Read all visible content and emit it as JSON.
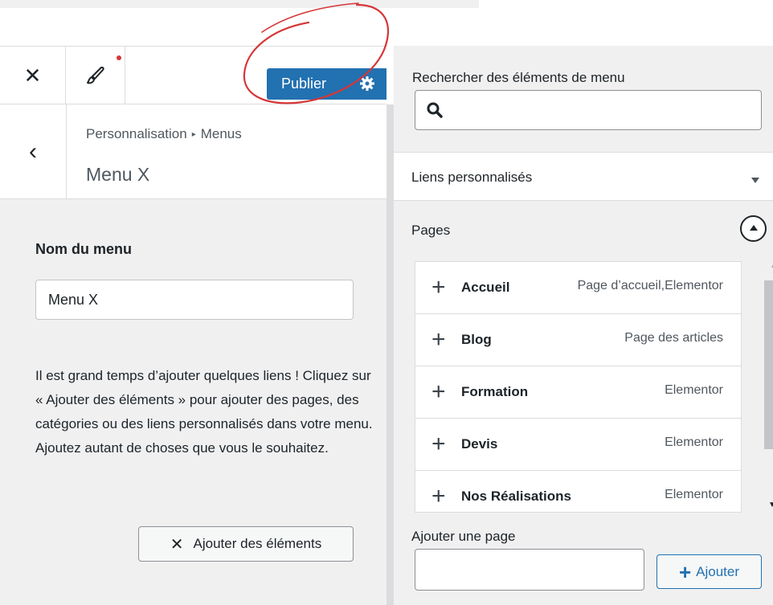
{
  "header": {
    "close_icon": "close-icon",
    "brush_icon": "paintbrush-icon",
    "publish_label": "Publier",
    "settings_icon": "gear-icon"
  },
  "title_bar": {
    "breadcrumb_root": "Personnalisation",
    "breadcrumb_separator": "▸",
    "breadcrumb_current": "Menus",
    "menu_title": "Menu X"
  },
  "menu_settings": {
    "name_label": "Nom du menu",
    "name_value": "Menu X",
    "help_text": "Il est grand temps d’ajouter quelques liens ! Cliquez sur « Ajouter des éléments » pour ajouter des pages, des catégories ou des liens personnalisés dans votre menu. Ajoutez autant de choses que vous le souhaitez.",
    "add_items_label": "Ajouter des éléments"
  },
  "search": {
    "label": "Rechercher des éléments de menu",
    "value": ""
  },
  "sections": {
    "custom_links_label": "Liens personnalisés",
    "pages_label": "Pages"
  },
  "pages": [
    {
      "title": "Accueil",
      "type": "Page d’accueil,Elementor"
    },
    {
      "title": "Blog",
      "type": "Page des articles"
    },
    {
      "title": "Formation",
      "type": "Elementor"
    },
    {
      "title": "Devis",
      "type": "Elementor"
    },
    {
      "title": "Nos Réalisations",
      "type": "Elementor"
    }
  ],
  "add_page": {
    "label": "Ajouter une page",
    "value": "",
    "button_label": "Ajouter"
  },
  "colors": {
    "accent": "#2271b1",
    "annotation": "#d63638",
    "panel_bg": "#f0f0f1"
  }
}
